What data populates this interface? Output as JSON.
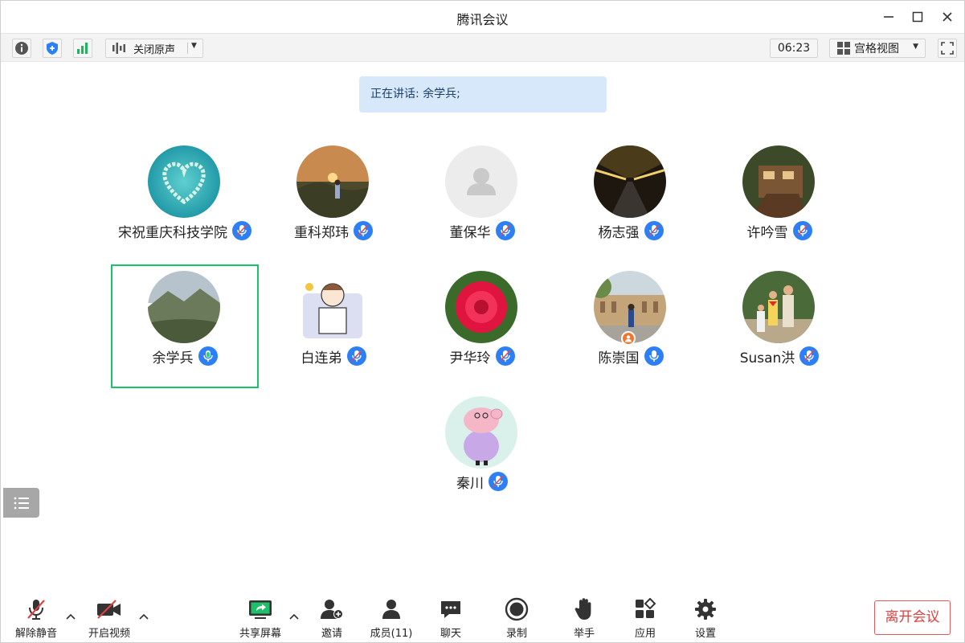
{
  "window": {
    "title": "腾讯会议"
  },
  "toolbar": {
    "audio_label": "关闭原声",
    "timer": "06:23",
    "view_label": "宫格视图"
  },
  "speaking": {
    "text": "正在讲话: 余学兵;"
  },
  "participants": [
    {
      "name": "宋祝重庆科技学院",
      "mic": "muted"
    },
    {
      "name": "重科郑玮",
      "mic": "muted"
    },
    {
      "name": "董保华",
      "mic": "muted"
    },
    {
      "name": "杨志强",
      "mic": "muted"
    },
    {
      "name": "许吟雪",
      "mic": "muted"
    },
    {
      "name": "余学兵",
      "mic": "speaking"
    },
    {
      "name": "白连弟",
      "mic": "muted"
    },
    {
      "name": "尹华玲",
      "mic": "muted"
    },
    {
      "name": "陈崇国",
      "mic": "on"
    },
    {
      "name": "Susan洪",
      "mic": "muted"
    },
    {
      "name": "秦川",
      "mic": "muted"
    }
  ],
  "bottom": {
    "unmute": "解除静音",
    "video": "开启视频",
    "share": "共享屏幕",
    "invite": "邀请",
    "members": "成员(11)",
    "chat": "聊天",
    "record": "录制",
    "raise_hand": "举手",
    "apps": "应用",
    "settings": "设置",
    "leave": "离开会议"
  },
  "colors": {
    "accent": "#2d7ff5",
    "speaking_border": "#19c36b",
    "leave": "#e0403f",
    "banner_bg": "#d7e8fb"
  }
}
